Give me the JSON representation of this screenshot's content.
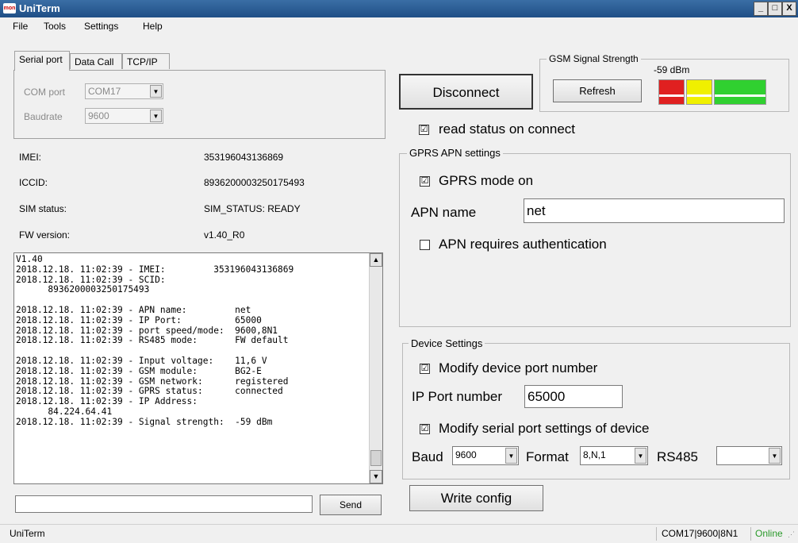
{
  "window": {
    "title": "UniTerm",
    "logo_text": "mon",
    "controls": {
      "minimize": "_",
      "maximize": "□",
      "close": "X"
    }
  },
  "menu": [
    "File",
    "Tools",
    "Settings",
    "Help"
  ],
  "tabs": [
    "Serial port",
    "Data Call",
    "TCP/IP"
  ],
  "serial": {
    "com_label": "COM port",
    "com_value": "COM17",
    "baud_label": "Baudrate",
    "baud_value": "9600"
  },
  "info": [
    {
      "label": "IMEI:",
      "value": "353196043136869"
    },
    {
      "label": "ICCID:",
      "value": "8936200003250175493"
    },
    {
      "label": "SIM status:",
      "value": "SIM_STATUS: READY"
    },
    {
      "label": "FW version:",
      "value": "v1.40_R0"
    }
  ],
  "log_text": "V1.40\n2018.12.18. 11:02:39 - IMEI:         353196043136869\n2018.12.18. 11:02:39 - SCID:\n      8936200003250175493\n\n2018.12.18. 11:02:39 - APN name:         net\n2018.12.18. 11:02:39 - IP Port:          65000\n2018.12.18. 11:02:39 - port speed/mode:  9600,8N1\n2018.12.18. 11:02:39 - RS485 mode:       FW default\n\n2018.12.18. 11:02:39 - Input voltage:    11,6 V\n2018.12.18. 11:02:39 - GSM module:       BG2-E\n2018.12.18. 11:02:39 - GSM network:      registered\n2018.12.18. 11:02:39 - GPRS status:      connected\n2018.12.18. 11:02:39 - IP Address:\n      84.224.64.41\n2018.12.18. 11:02:39 - Signal strength:  -59 dBm",
  "send": {
    "input_value": "",
    "button_label": "Send"
  },
  "connection": {
    "disconnect_label": "Disconnect",
    "read_status_label": "read status on connect",
    "read_status_checked": "☑"
  },
  "gsm": {
    "group_title": "GSM Signal Strength",
    "value": "-59 dBm",
    "refresh_label": "Refresh",
    "bar_colors": {
      "low": "#e02020",
      "mid": "#f0f000",
      "high": "#30d030"
    }
  },
  "gprs": {
    "group_title": "GPRS APN settings",
    "mode_label": "GPRS mode on",
    "mode_check": "☑",
    "apn_label": "APN name",
    "apn_value": "net",
    "auth_label": "APN requires authentication",
    "auth_check": ""
  },
  "device": {
    "group_title": "Device Settings",
    "modify_port_label": "Modify device port number",
    "modify_port_check": "☑",
    "ip_port_label": "IP Port number",
    "ip_port_value": "65000",
    "modify_serial_label": "Modify serial port settings of device",
    "modify_serial_check": "☑",
    "baud_label": "Baud",
    "baud_value": "9600",
    "format_label": "Format",
    "format_value": "8,N,1",
    "rs485_label": "RS485",
    "rs485_value": "",
    "write_config_label": "Write config"
  },
  "statusbar": {
    "left": "UniTerm",
    "port": "COM17|9600|8N1",
    "state": "Online"
  },
  "colors": {
    "title_bar": "#1f4f86",
    "online": "#2a9a2a"
  }
}
